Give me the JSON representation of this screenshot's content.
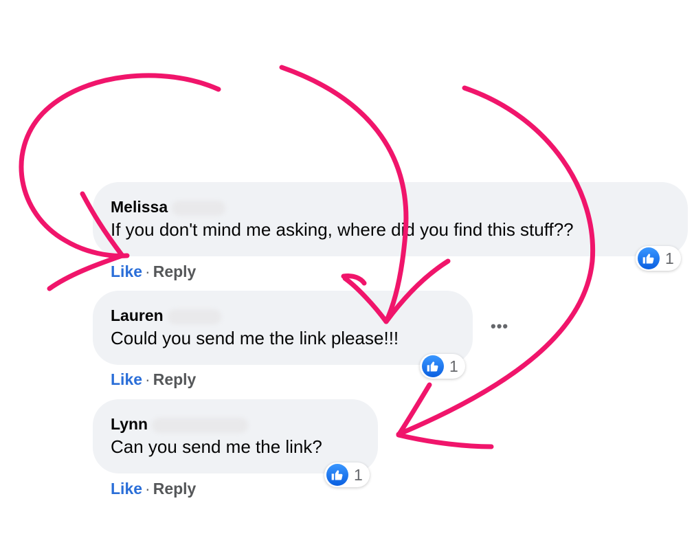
{
  "comments": [
    {
      "author": "Melissa",
      "text": "If you don't mind me asking, where did you find this stuff??",
      "reaction_count": "1",
      "like_label": "Like",
      "separator": "·",
      "reply_label": "Reply"
    },
    {
      "author": "Lauren",
      "text": "Could you send me the link please!!!",
      "reaction_count": "1",
      "like_label": "Like",
      "separator": "·",
      "reply_label": "Reply",
      "more_label": "•••"
    },
    {
      "author": "Lynn",
      "text": "Can you send me the link?",
      "reaction_count": "1",
      "like_label": "Like",
      "separator": "·",
      "reply_label": "Reply"
    }
  ],
  "icons": {
    "reaction": "thumbs-up-icon",
    "more": "more-options-icon"
  },
  "colors": {
    "like_link": "#2a6ed8",
    "bubble_bg": "#f0f2f5",
    "annotation_arrow": "#f0156b",
    "reaction_blue": "#1877f2"
  }
}
